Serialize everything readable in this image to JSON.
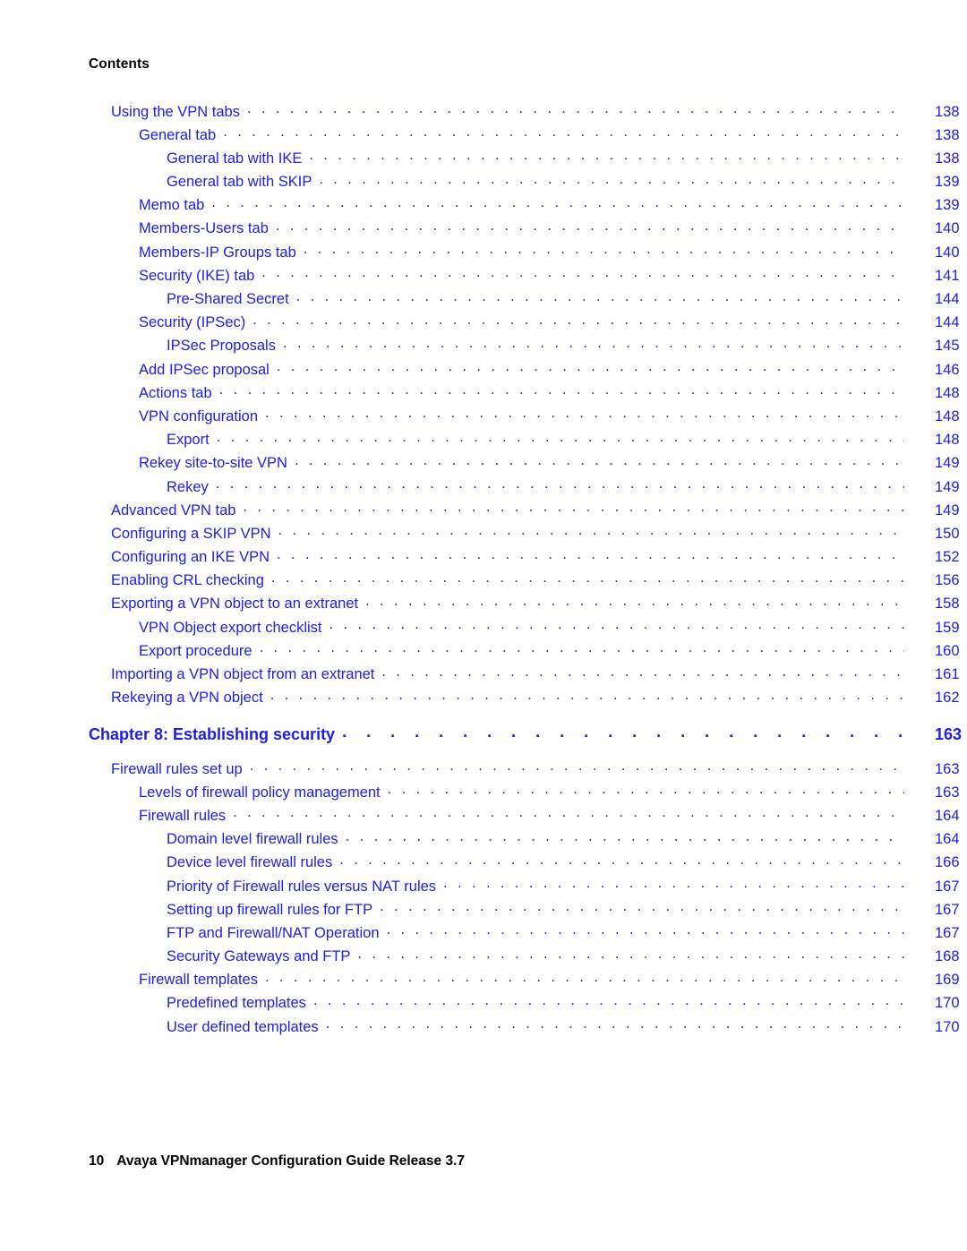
{
  "document": {
    "running_head": "Contents",
    "text_color": "#2020E0",
    "heading_color": "#000000"
  },
  "footer": {
    "page_number": "10",
    "title": "Avaya VPNmanager Configuration Guide Release 3.7"
  },
  "toc": {
    "entries": [
      {
        "title": "Using the VPN tabs",
        "page": "138",
        "level": 1,
        "chapter": false
      },
      {
        "title": "General tab",
        "page": "138",
        "level": 2,
        "chapter": false
      },
      {
        "title": "General tab with IKE",
        "page": "138",
        "level": 3,
        "chapter": false
      },
      {
        "title": "General tab with SKIP",
        "page": "139",
        "level": 3,
        "chapter": false
      },
      {
        "title": "Memo tab",
        "page": "139",
        "level": 2,
        "chapter": false
      },
      {
        "title": "Members-Users tab",
        "page": "140",
        "level": 2,
        "chapter": false
      },
      {
        "title": "Members-IP Groups tab",
        "page": "140",
        "level": 2,
        "chapter": false
      },
      {
        "title": "Security (IKE) tab",
        "page": "141",
        "level": 2,
        "chapter": false
      },
      {
        "title": "Pre-Shared Secret",
        "page": "144",
        "level": 3,
        "chapter": false
      },
      {
        "title": "Security (IPSec)",
        "page": "144",
        "level": 2,
        "chapter": false
      },
      {
        "title": "IPSec Proposals",
        "page": "145",
        "level": 3,
        "chapter": false
      },
      {
        "title": "Add IPSec proposal",
        "page": "146",
        "level": 2,
        "chapter": false
      },
      {
        "title": "Actions tab",
        "page": "148",
        "level": 2,
        "chapter": false
      },
      {
        "title": "VPN configuration",
        "page": "148",
        "level": 2,
        "chapter": false
      },
      {
        "title": "Export",
        "page": "148",
        "level": 3,
        "chapter": false
      },
      {
        "title": "Rekey site-to-site VPN",
        "page": "149",
        "level": 2,
        "chapter": false
      },
      {
        "title": "Rekey",
        "page": "149",
        "level": 3,
        "chapter": false
      },
      {
        "title": "Advanced VPN tab",
        "page": "149",
        "level": 1,
        "chapter": false
      },
      {
        "title": "Configuring a SKIP VPN",
        "page": "150",
        "level": 1,
        "chapter": false
      },
      {
        "title": "Configuring an IKE VPN",
        "page": "152",
        "level": 1,
        "chapter": false
      },
      {
        "title": "Enabling CRL checking",
        "page": "156",
        "level": 1,
        "chapter": false
      },
      {
        "title": "Exporting a VPN object to an extranet",
        "page": "158",
        "level": 1,
        "chapter": false
      },
      {
        "title": "VPN Object export checklist",
        "page": "159",
        "level": 2,
        "chapter": false
      },
      {
        "title": "Export procedure",
        "page": "160",
        "level": 2,
        "chapter": false
      },
      {
        "title": "Importing a VPN object from an extranet",
        "page": "161",
        "level": 1,
        "chapter": false
      },
      {
        "title": "Rekeying a VPN object",
        "page": "162",
        "level": 1,
        "chapter": false
      },
      {
        "title": "Chapter 8: Establishing security",
        "page": "163",
        "level": 0,
        "chapter": true
      },
      {
        "title": "Firewall rules set up",
        "page": "163",
        "level": 1,
        "chapter": false
      },
      {
        "title": "Levels of firewall policy management",
        "page": "163",
        "level": 2,
        "chapter": false
      },
      {
        "title": "Firewall rules",
        "page": "164",
        "level": 2,
        "chapter": false
      },
      {
        "title": "Domain level firewall rules",
        "page": "164",
        "level": 3,
        "chapter": false
      },
      {
        "title": "Device level firewall rules",
        "page": "166",
        "level": 3,
        "chapter": false
      },
      {
        "title": "Priority of Firewall rules versus NAT rules",
        "page": "167",
        "level": 3,
        "chapter": false
      },
      {
        "title": "Setting up firewall rules for FTP",
        "page": "167",
        "level": 3,
        "chapter": false
      },
      {
        "title": "FTP and Firewall/NAT Operation",
        "page": "167",
        "level": 3,
        "chapter": false
      },
      {
        "title": "Security Gateways and FTP",
        "page": "168",
        "level": 3,
        "chapter": false
      },
      {
        "title": "Firewall templates",
        "page": "169",
        "level": 2,
        "chapter": false
      },
      {
        "title": "Predefined templates",
        "page": "170",
        "level": 3,
        "chapter": false
      },
      {
        "title": "User defined templates",
        "page": "170",
        "level": 3,
        "chapter": false
      }
    ]
  }
}
